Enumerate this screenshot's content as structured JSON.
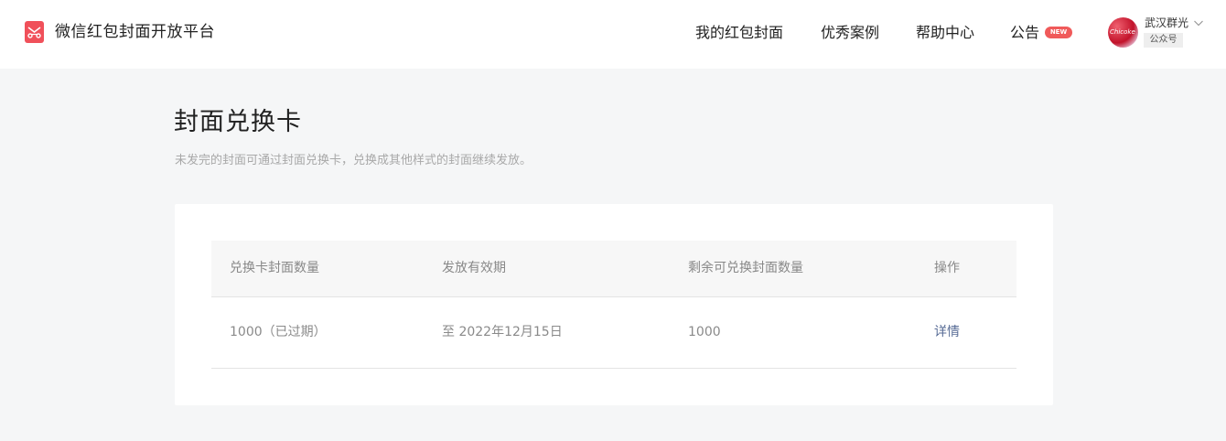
{
  "header": {
    "brand": "微信红包封面开放平台",
    "nav": [
      {
        "label": "我的红包封面"
      },
      {
        "label": "优秀案例"
      },
      {
        "label": "帮助中心"
      },
      {
        "label": "公告"
      }
    ],
    "announcement_badge": "NEW",
    "user": {
      "name": "武汉群光",
      "account_type": "公众号",
      "avatar_text": "Chicoke"
    }
  },
  "page": {
    "title": "封面兑换卡",
    "description": "未发完的封面可通过封面兑换卡，兑换成其他样式的封面继续发放。"
  },
  "table": {
    "columns": [
      "兑换卡封面数量",
      "发放有效期",
      "剩余可兑换封面数量",
      "操作"
    ],
    "rows": [
      {
        "quantity": "1000（已过期）",
        "validity": "至 2022年12月15日",
        "remaining": "1000",
        "action": "详情"
      }
    ]
  },
  "colors": {
    "brand_red": "#f0505a",
    "link_blue": "#576b95",
    "badge_red": "#f05a5a",
    "page_bg": "#f5f6f7"
  },
  "icons": {
    "logo": "red-envelope-logo-icon",
    "user_menu": "chevron-down-icon"
  }
}
